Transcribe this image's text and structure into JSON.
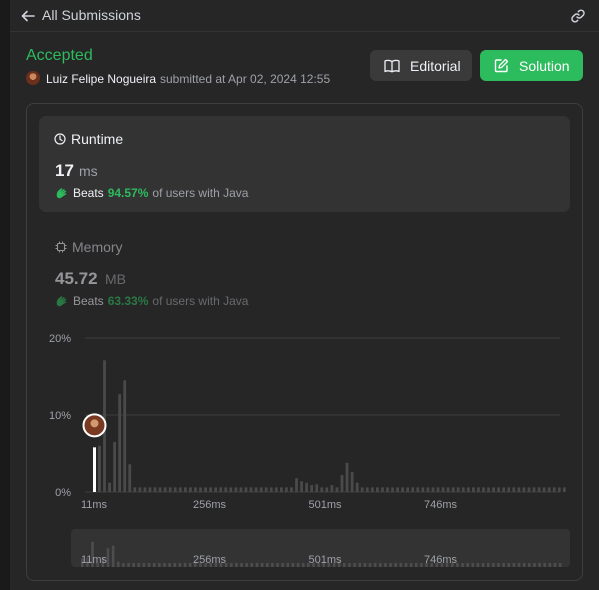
{
  "topbar": {
    "back_label": "All Submissions"
  },
  "submission": {
    "status": "Accepted",
    "author": "Luiz Felipe Nogueira",
    "submitted_text": "submitted at Apr 02, 2024 12:55"
  },
  "buttons": {
    "editorial": "Editorial",
    "solution": "Solution"
  },
  "runtime": {
    "label": "Runtime",
    "value": "17",
    "unit": "ms",
    "beats_label": "Beats",
    "beats_pct": "94.57%",
    "beats_rest": "of users with Java"
  },
  "memory": {
    "label": "Memory",
    "value": "45.72",
    "unit": "MB",
    "beats_label": "Beats",
    "beats_pct": "63.33%",
    "beats_rest": "of users with Java"
  },
  "colors": {
    "accent": "#2cbb5d",
    "panel": "#262626",
    "bar": "#4a4a4a",
    "text_muted": "#9ea1a8"
  },
  "chart_data": {
    "type": "bar",
    "ylabel_ticks": [
      "20%",
      "10%",
      "0%"
    ],
    "ylim": [
      0,
      20
    ],
    "x_ticks": [
      "11ms",
      "256ms",
      "501ms",
      "746ms"
    ],
    "user_position": "11ms",
    "values": [
      5.8,
      6.0,
      17.1,
      1.2,
      6.5,
      12.7,
      14.5,
      3.6,
      0.6,
      0.6,
      0.6,
      0.6,
      0.6,
      0.6,
      0.6,
      0.6,
      0.6,
      0.6,
      0.6,
      0.6,
      0.6,
      0.6,
      0.6,
      0.6,
      0.6,
      0.6,
      0.6,
      0.6,
      0.6,
      0.6,
      0.6,
      0.6,
      0.6,
      0.6,
      0.6,
      0.6,
      0.6,
      0.6,
      0.6,
      0.6,
      1.8,
      1.4,
      1.2,
      0.9,
      1.0,
      0.6,
      0.6,
      0.9,
      0.6,
      2.2,
      3.8,
      2.6,
      1.2,
      0.6,
      0.6,
      0.6,
      0.6,
      0.6,
      0.6,
      0.6,
      0.6,
      0.6,
      0.6,
      0.6,
      0.6,
      0.6,
      0.6,
      0.6,
      0.6,
      0.6,
      0.6,
      0.6,
      0.6,
      0.6,
      0.6,
      0.6,
      0.6,
      0.6,
      0.6,
      0.6,
      0.6,
      0.6,
      0.6,
      0.6,
      0.6,
      0.6,
      0.6,
      0.6,
      0.6,
      0.6,
      0.6,
      0.6,
      0.6,
      0.6
    ],
    "highlight_index": 0,
    "grid": true
  }
}
